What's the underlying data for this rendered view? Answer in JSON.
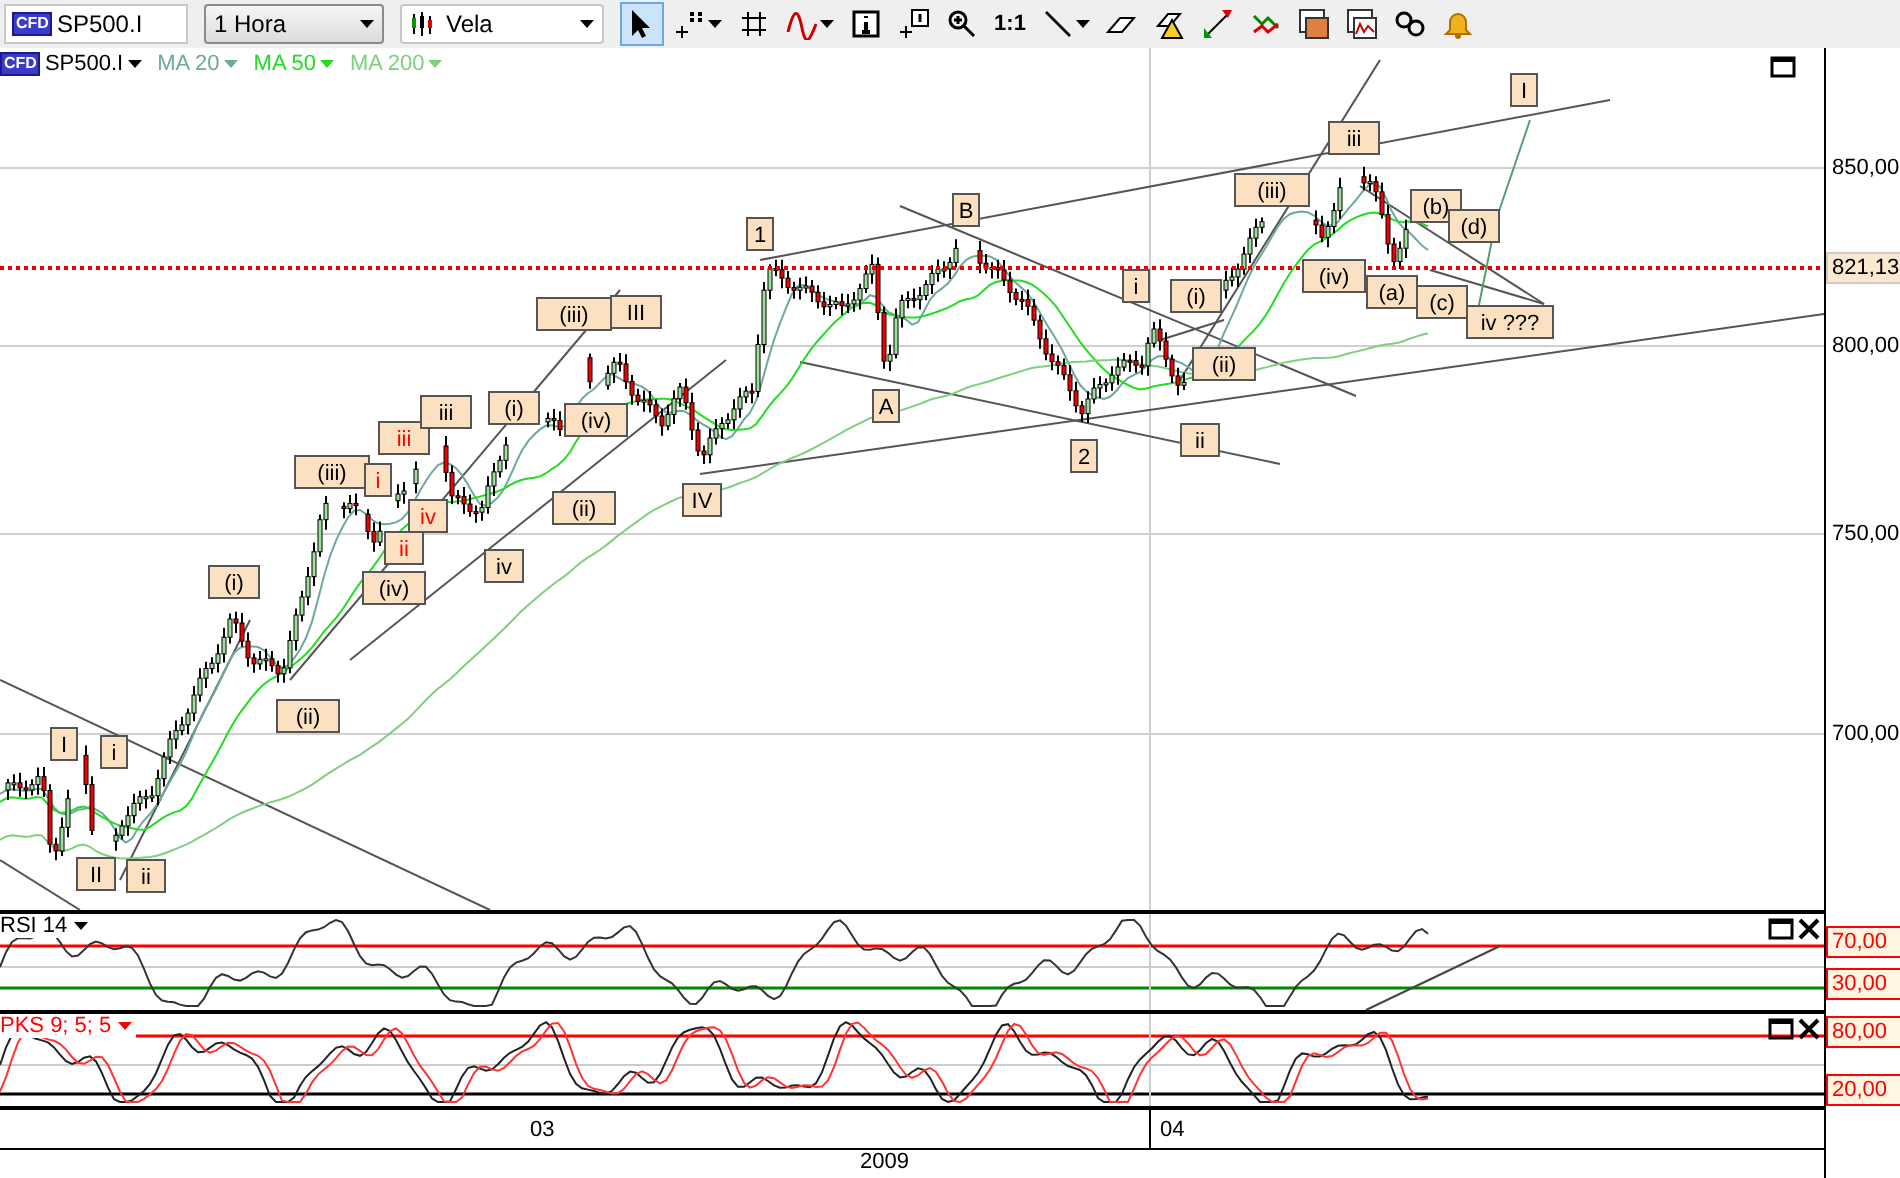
{
  "toolbar": {
    "symbol_badge": "CFD",
    "symbol": "SP500.I",
    "timeframe": "1 Hora",
    "chart_type": "Vela",
    "tools": [
      {
        "kind": "pointer",
        "selected": true
      },
      {
        "kind": "crosshair",
        "selected": false
      },
      {
        "kind": "grid",
        "selected": false
      },
      {
        "kind": "indicator",
        "selected": false
      },
      {
        "kind": "info",
        "selected": false
      },
      {
        "kind": "note",
        "selected": false
      },
      {
        "kind": "zoom",
        "selected": false
      },
      {
        "kind": "ratio",
        "label": "1:1",
        "selected": false
      },
      {
        "kind": "line",
        "selected": false
      },
      {
        "kind": "eraser",
        "selected": false
      },
      {
        "kind": "warning",
        "selected": false
      },
      {
        "kind": "arrows",
        "selected": false
      },
      {
        "kind": "trades",
        "selected": false
      },
      {
        "kind": "window",
        "selected": false
      },
      {
        "kind": "chart-window",
        "selected": false
      },
      {
        "kind": "link",
        "selected": false
      },
      {
        "kind": "bell",
        "selected": false
      }
    ]
  },
  "legend": {
    "badge": "CFD",
    "symbol": "SP500.I",
    "averages": [
      {
        "label": "MA 20",
        "color": "#6fa89c"
      },
      {
        "label": "MA 50",
        "color": "#22dd22"
      },
      {
        "label": "MA 200",
        "color": "#7fcf7f"
      }
    ]
  },
  "price_axis": {
    "ticks": [
      "850,00",
      "800,00",
      "750,00",
      "700,00"
    ],
    "current_price": "821,13"
  },
  "wave_labels": [
    {
      "text": "I",
      "color": "#000000"
    },
    {
      "text": "i",
      "color": "#000000"
    },
    {
      "text": "II",
      "color": "#000000"
    },
    {
      "text": "ii",
      "color": "#000000"
    },
    {
      "text": "(i)",
      "color": "#000000"
    },
    {
      "text": "(ii)",
      "color": "#000000"
    },
    {
      "text": "(iii)",
      "color": "#000000"
    },
    {
      "text": "i",
      "color": "#ff0000"
    },
    {
      "text": "iii",
      "color": "#ff0000"
    },
    {
      "text": "iii",
      "color": "#000000"
    },
    {
      "text": "iv",
      "color": "#ff0000"
    },
    {
      "text": "ii",
      "color": "#ff0000"
    },
    {
      "text": "(iv)",
      "color": "#000000"
    },
    {
      "text": "iv",
      "color": "#000000"
    },
    {
      "text": "(i)",
      "color": "#000000"
    },
    {
      "text": "(iii)",
      "color": "#000000"
    },
    {
      "text": "III",
      "color": "#000000"
    },
    {
      "text": "(iv)",
      "color": "#000000"
    },
    {
      "text": "(ii)",
      "color": "#000000"
    },
    {
      "text": "IV",
      "color": "#000000"
    },
    {
      "text": "A",
      "color": "#000000"
    },
    {
      "text": "1",
      "color": "#000000"
    },
    {
      "text": "B",
      "color": "#000000"
    },
    {
      "text": "2",
      "color": "#000000"
    },
    {
      "text": "i",
      "color": "#000000"
    },
    {
      "text": "(i)",
      "color": "#000000"
    },
    {
      "text": "(ii)",
      "color": "#000000"
    },
    {
      "text": "ii",
      "color": "#000000"
    },
    {
      "text": "(iii)",
      "color": "#000000"
    },
    {
      "text": "iii",
      "color": "#000000"
    },
    {
      "text": "(iv)",
      "color": "#000000"
    },
    {
      "text": "(a)",
      "color": "#000000"
    },
    {
      "text": "(b)",
      "color": "#000000"
    },
    {
      "text": "(c)",
      "color": "#000000"
    },
    {
      "text": "(d)",
      "color": "#000000"
    },
    {
      "text": "iv ???",
      "color": "#000000"
    },
    {
      "text": "I",
      "color": "#000000"
    }
  ],
  "indicators": [
    {
      "kind": "rsi",
      "title": "RSI 14",
      "color": "#000000",
      "levels": [
        "70,00",
        "30,00"
      ]
    },
    {
      "kind": "stochastic",
      "title": "PKS 9; 5; 5",
      "color": "#ff0000",
      "levels": [
        "80,00",
        "20,00"
      ]
    }
  ],
  "time_axis": {
    "labels": [
      "03",
      "04"
    ],
    "year": "2009"
  }
}
